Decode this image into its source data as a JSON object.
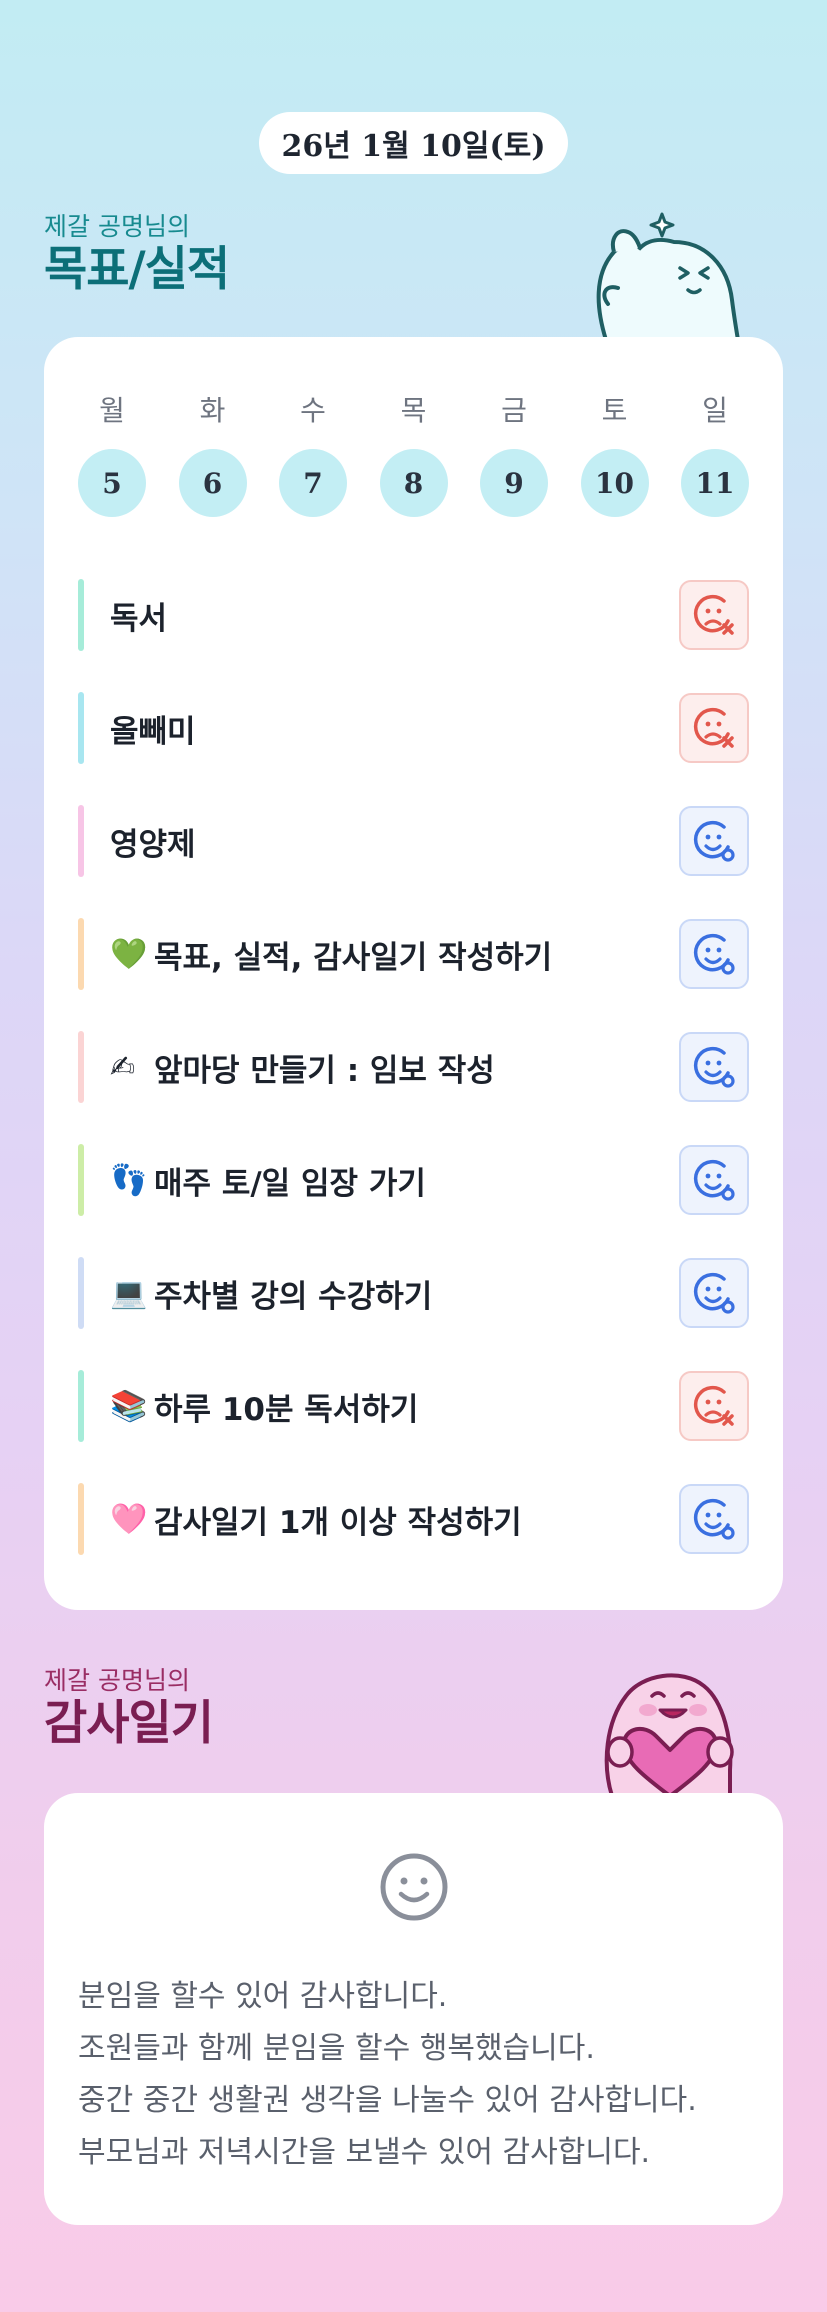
{
  "date": "26년 1월 10일(토)",
  "goals_section": {
    "subtitle": "제갈 공명님의",
    "title": "목표/실적"
  },
  "week": {
    "labels": [
      "월",
      "화",
      "수",
      "목",
      "금",
      "토",
      "일"
    ],
    "days": [
      "5",
      "6",
      "7",
      "8",
      "9",
      "10",
      "11"
    ]
  },
  "goals": [
    {
      "emoji": "",
      "text": "독서",
      "status": "fail",
      "bar_color": "#a6ecd9"
    },
    {
      "emoji": "",
      "text": "올빼미",
      "status": "fail",
      "bar_color": "#a8e6f0"
    },
    {
      "emoji": "",
      "text": "영양제",
      "status": "success",
      "bar_color": "#f7c5e6"
    },
    {
      "emoji": "💚",
      "text": "목표, 실적, 감사일기 작성하기",
      "status": "success",
      "bar_color": "#fcd9b0"
    },
    {
      "emoji": "✍",
      "text": "앞마당 만들기 : 임보 작성",
      "status": "success",
      "bar_color": "#fbd4d4"
    },
    {
      "emoji": "👣",
      "text": "매주 토/일 임장 가기",
      "status": "success",
      "bar_color": "#cdeda7"
    },
    {
      "emoji": "💻",
      "text": "주차별 강의 수강하기",
      "status": "success",
      "bar_color": "#cfdcf5"
    },
    {
      "emoji": "📚",
      "text": "하루 10분 독서하기",
      "status": "fail",
      "bar_color": "#a6ecd9"
    },
    {
      "emoji": "🩷",
      "text": "감사일기 1개 이상 작성하기",
      "status": "success",
      "bar_color": "#fcd9b0"
    }
  ],
  "diary_section": {
    "subtitle": "제갈 공명님의",
    "title": "감사일기"
  },
  "diary": {
    "icon": "smile-icon",
    "lines": [
      "분임을 할수 있어 감사합니다.",
      "조원들과 함께 분임을 할수 행복했습니다.",
      "중간 중간 생활권 생각을 나눌수 있어 감사합니다.",
      "부모님과 저녁시간을 보낼수 있어 감사합니다."
    ]
  },
  "colors": {
    "fail": "#e2574c",
    "success": "#3a6fe0",
    "day_circle": "#c3eef4",
    "teal_title": "#0c6f78",
    "plum_title": "#7a1e52"
  }
}
